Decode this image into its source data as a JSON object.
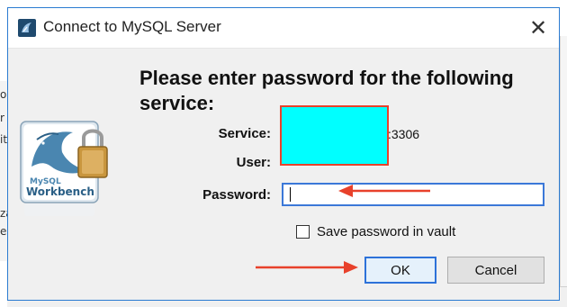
{
  "window": {
    "title": "Connect to MySQL Server",
    "close_glyph": "✕"
  },
  "dialog": {
    "prompt": "Please enter password for the following service:",
    "fields": {
      "service_label": "Service:",
      "service_value_suffix": ":3306",
      "user_label": "User:",
      "password_label": "Password:"
    },
    "password_value": "",
    "save_in_vault_label": "Save password in vault",
    "save_in_vault_checked": false,
    "ok_label": "OK",
    "cancel_label": "Cancel"
  },
  "logo": {
    "brand_small": "MySQL",
    "brand": "Workbench"
  },
  "annotations": {
    "redaction_color": "#00ffff",
    "arrow_color": "#e8412b"
  },
  "background": {
    "left_edge_chars": [
      "o",
      "r",
      "it",
      "za",
      "e"
    ]
  }
}
